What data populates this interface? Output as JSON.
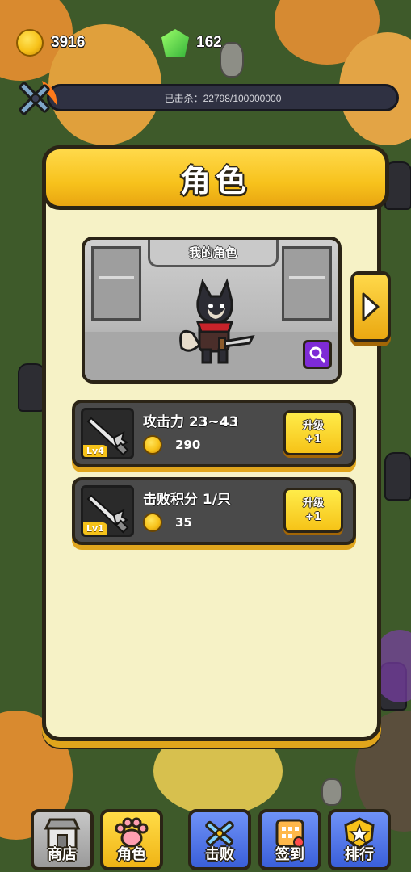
{
  "hud": {
    "coins": "3916",
    "gems": "162",
    "kill_progress": "已击杀：22798/100000000"
  },
  "panel": {
    "title": "角色",
    "character_label": "我的角色"
  },
  "upgrades": [
    {
      "level": "Lv4",
      "title": "攻击力 23~43",
      "cost": "290",
      "button_line1": "升级",
      "button_line2": "+1"
    },
    {
      "level": "Lv1",
      "title": "击败积分 1/只",
      "cost": "35",
      "button_line1": "升级",
      "button_line2": "+1"
    }
  ],
  "nav": [
    {
      "label": "商店",
      "icon": "shop-icon"
    },
    {
      "label": "角色",
      "icon": "paw-icon"
    },
    {
      "label": "击败",
      "icon": "crossed-swords-icon"
    },
    {
      "label": "签到",
      "icon": "calendar-icon"
    },
    {
      "label": "排行",
      "icon": "rank-badge-icon"
    }
  ],
  "colors": {
    "panel_bg": "#f6f2c6",
    "header_gold": "#f7c21c",
    "card_gray": "#4a4a4a",
    "nav_blue": "#3a5fd9",
    "search_purple": "#7e2bd6"
  }
}
